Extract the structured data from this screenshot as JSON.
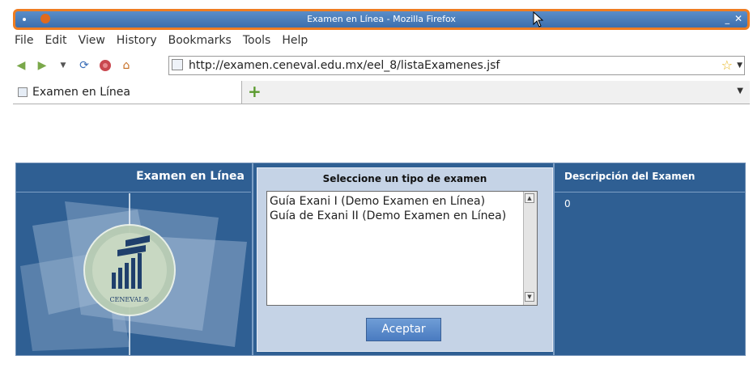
{
  "window": {
    "title": "Examen en Línea - Mozilla Firefox",
    "minimize_glyph": "_",
    "close_glyph": "✕"
  },
  "menu": [
    "File",
    "Edit",
    "View",
    "History",
    "Bookmarks",
    "Tools",
    "Help"
  ],
  "nav": {
    "url": "http://examen.ceneval.edu.mx/eel_8/listaExamenes.jsf"
  },
  "tabs": [
    {
      "label": "Examen en Línea"
    }
  ],
  "page": {
    "left_header": "Examen en Línea",
    "logo_text": "CENEVAL®",
    "center_header": "Seleccione un tipo de examen",
    "exam_options": [
      "Guía Exani I (Demo Examen en Línea)",
      "Guía de Exani II (Demo Examen en Línea)"
    ],
    "accept_label": "Aceptar",
    "right_header": "Descripción del Examen",
    "description_value": "0"
  },
  "colors": {
    "titlebar": "#3d6fad",
    "titlebar_highlight": "#ef7d22",
    "panel": "#2f5f93",
    "center_panel": "#c5d3e6",
    "button": "#4a7bc0"
  }
}
